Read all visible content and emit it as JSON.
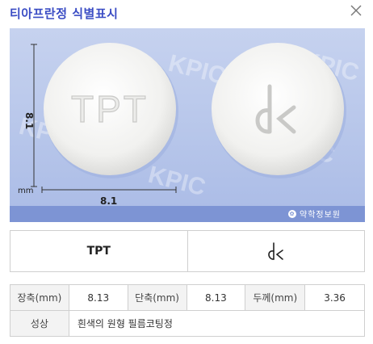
{
  "window": {
    "title": "티아프란정 식별표시",
    "close_icon": "close-icon"
  },
  "photo": {
    "watermark": "KPIC",
    "dimension_vertical": "8.1",
    "dimension_horizontal": "8.1",
    "dimension_unit": "mm",
    "front_imprint": "TPT",
    "back_imprint": "dk",
    "brand": "약학정보원"
  },
  "marks": {
    "front": "TPT",
    "back": "dk"
  },
  "specs": {
    "long_axis_label": "장축(mm)",
    "long_axis_value": "8.13",
    "short_axis_label": "단축(mm)",
    "short_axis_value": "8.13",
    "thickness_label": "두께(mm)",
    "thickness_value": "3.36",
    "appearance_label": "성상",
    "appearance_value": "흰색의 원형 필름코팅정"
  },
  "colors": {
    "title": "#3a4cc4",
    "photo_bg": "#b7c6ea",
    "band": "#7d94d4",
    "tablet": "#f4f4f2"
  }
}
